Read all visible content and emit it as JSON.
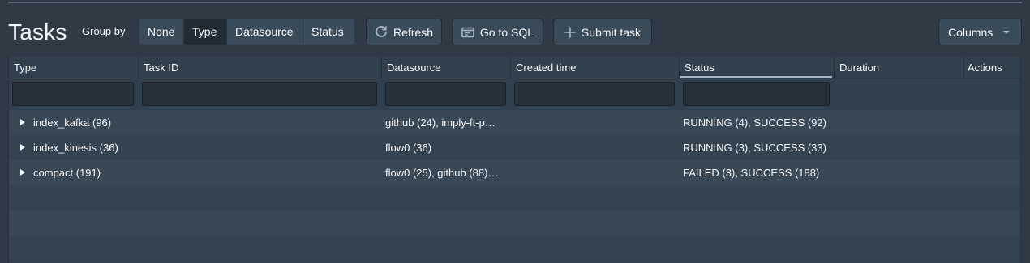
{
  "page": {
    "title": "Tasks"
  },
  "group_by": {
    "label": "Group by",
    "options": [
      "None",
      "Type",
      "Datasource",
      "Status"
    ],
    "selected": "Type"
  },
  "toolbar": {
    "refresh_label": "Refresh",
    "sql_label": "Go to SQL",
    "submit_label": "Submit task",
    "columns_label": "Columns"
  },
  "table": {
    "columns": [
      "Type",
      "Task ID",
      "Datasource",
      "Created time",
      "Status",
      "Duration",
      "Actions"
    ],
    "sorted_column": "Status",
    "rows": [
      {
        "type": "index_kafka (96)",
        "datasource": "github (24), imply-ft-p…",
        "status": "RUNNING (4), SUCCESS (92)"
      },
      {
        "type": "index_kinesis (36)",
        "datasource": "flow0 (36)",
        "status": "RUNNING (3), SUCCESS (33)"
      },
      {
        "type": "compact (191)",
        "datasource": "flow0 (25), github (88)…",
        "status": "FAILED (3), SUCCESS (188)"
      }
    ]
  }
}
